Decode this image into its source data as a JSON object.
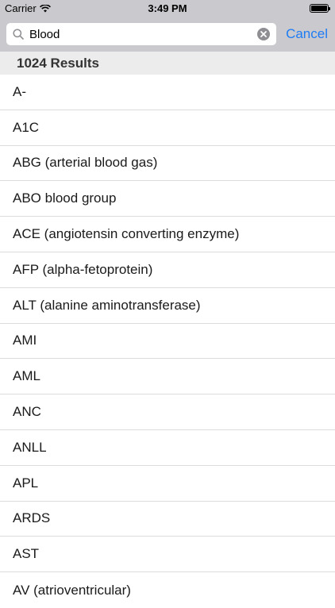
{
  "status_bar": {
    "carrier": "Carrier",
    "time": "3:49 PM"
  },
  "search": {
    "value": "Blood",
    "cancel_label": "Cancel"
  },
  "results": {
    "header": "1024 Results",
    "items": [
      "A-",
      "A1C",
      "ABG (arterial blood gas)",
      "ABO blood group",
      "ACE (angiotensin converting enzyme)",
      "AFP (alpha-fetoprotein)",
      "ALT (alanine aminotransferase)",
      "AMI",
      "AML",
      "ANC",
      "ANLL",
      "APL",
      "ARDS",
      "AST",
      "AV (atrioventricular)"
    ]
  },
  "colors": {
    "accent": "#1e7cf5",
    "bar_background": "#c9c9ce",
    "section_header": "#ececec"
  }
}
